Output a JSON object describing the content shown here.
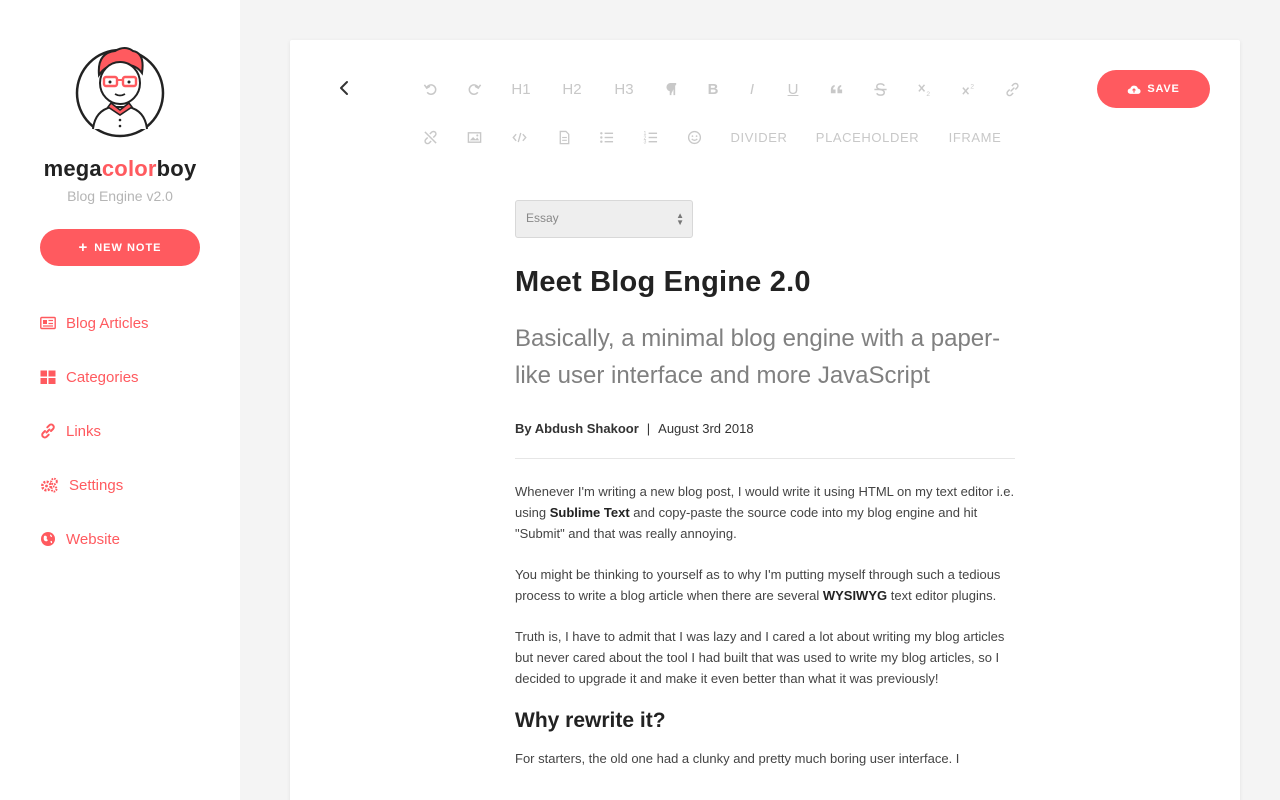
{
  "sidebar": {
    "brand": {
      "part1": "mega",
      "part2": "color",
      "part3": "boy"
    },
    "version": "Blog Engine v2.0",
    "new_note_label": "NEW NOTE",
    "items": [
      {
        "label": "Blog Articles",
        "icon": "newspaper-icon"
      },
      {
        "label": "Categories",
        "icon": "grid-icon"
      },
      {
        "label": "Links",
        "icon": "link-icon"
      },
      {
        "label": "Settings",
        "icon": "gears-icon"
      },
      {
        "label": "Website",
        "icon": "globe-icon"
      }
    ]
  },
  "toolbar": {
    "buttons": [
      "undo",
      "redo",
      "H1",
      "H2",
      "H3",
      "paragraph",
      "B",
      "I",
      "U",
      "quote",
      "strikethrough",
      "subscript",
      "superscript",
      "link",
      "unlink",
      "image",
      "code",
      "file",
      "bullet-list",
      "numbered-list",
      "emoji"
    ],
    "words": [
      "DIVIDER",
      "PLACEHOLDER",
      "IFRAME"
    ],
    "h1": "H1",
    "h2": "H2",
    "h3": "H3",
    "bold": "B",
    "italic": "I",
    "underline": "U",
    "save_label": "SAVE"
  },
  "editor": {
    "category": "Essay",
    "title": "Meet Blog Engine 2.0",
    "subtitle": "Basically, a minimal blog engine with a paper-like user interface and more JavaScript",
    "author": "By Abdush Shakoor",
    "separator": "|",
    "date": "August 3rd 2018",
    "p1_a": "Whenever I'm writing a new blog post, I would write it using HTML on my text editor i.e. using ",
    "p1_b": "Sublime Text",
    "p1_c": " and copy-paste the source code into my blog engine and hit \"Submit\" and that was really annoying.",
    "p2_a": "You might be thinking to yourself as to why I'm putting myself through such a tedious process to write a blog article when there are several ",
    "p2_b": "WYSIWYG",
    "p2_c": " text editor plugins.",
    "p3": "Truth is, I have to admit that I was lazy and I cared a lot about writing my blog articles but never cared about the tool I had built that was used to write my blog articles, so I decided to upgrade it and make it even better than what it was previously!",
    "h2": "Why rewrite it?",
    "p4": "For starters, the old one had a clunky and pretty much boring user interface. I"
  },
  "colors": {
    "accent": "#ff5a5f",
    "toolbar_icon": "#c8c8c8",
    "background": "#f4f4f4"
  }
}
